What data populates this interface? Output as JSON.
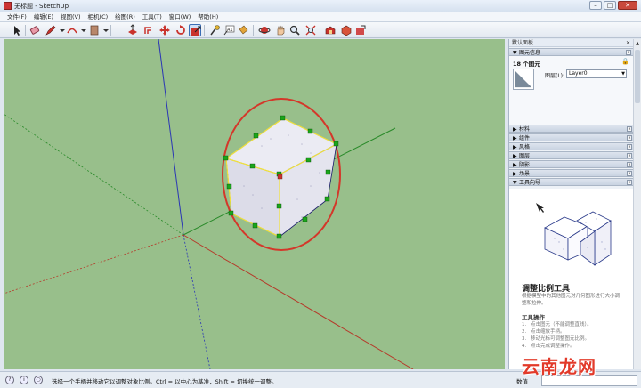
{
  "window": {
    "title": "无标题 - SketchUp",
    "buttons": {
      "minimize": "–",
      "maximize": "□",
      "close": "✕"
    }
  },
  "menu": [
    "文件(F)",
    "编辑(E)",
    "视图(V)",
    "相机(C)",
    "绘图(R)",
    "工具(T)",
    "窗口(W)",
    "帮助(H)"
  ],
  "toolbar": {
    "tools": [
      "select-tool",
      "eraser-tool",
      "pencil-tool",
      "arc-tool",
      "rectangle-tool",
      "push-pull-tool",
      "offset-tool",
      "move-tool",
      "rotate-tool",
      "scale-tool",
      "tape-measure-tool",
      "text-tool",
      "paint-bucket-tool",
      "orbit-tool",
      "pan-tool",
      "zoom-tool",
      "zoom-extents-tool",
      "warehouse-tool",
      "extension-tool",
      "share-tool"
    ],
    "active_tool": "scale-tool"
  },
  "tray": {
    "title": "默认面板",
    "entity_info": {
      "header": "图元信息",
      "count": "18 个图元",
      "layer_label": "图层(L):",
      "layer_value": "Layer0"
    },
    "panels": [
      "材料",
      "组件",
      "风格",
      "图层",
      "阴影",
      "场景"
    ],
    "instructor": {
      "header": "工具向导",
      "title": "调整比例工具",
      "description": "根据模型中的其他图元对几何图形进行大小调整和拉伸。",
      "subtitle": "工具操作",
      "steps": [
        {
          "num": "1.",
          "text": "点击图元（不能调整直线）。"
        },
        {
          "num": "2.",
          "text": "点击缩放手柄。"
        },
        {
          "num": "3.",
          "text": "移动光标可调整图元比例。"
        },
        {
          "num": "4.",
          "text": "点击完成调整操作。"
        }
      ]
    }
  },
  "status": {
    "hint": "选择一个手柄并移动它以调整对象比例。Ctrl = 以中心为基准，Shift = 切换统一调整。",
    "value_label": "数值",
    "value": ""
  },
  "watermark": "云南龙网",
  "colors": {
    "viewport_bg": "#98bf8b",
    "selection_ellipse": "#d4372a",
    "grip_green": "#1aa51a",
    "box_face": "#e6e6f0"
  }
}
